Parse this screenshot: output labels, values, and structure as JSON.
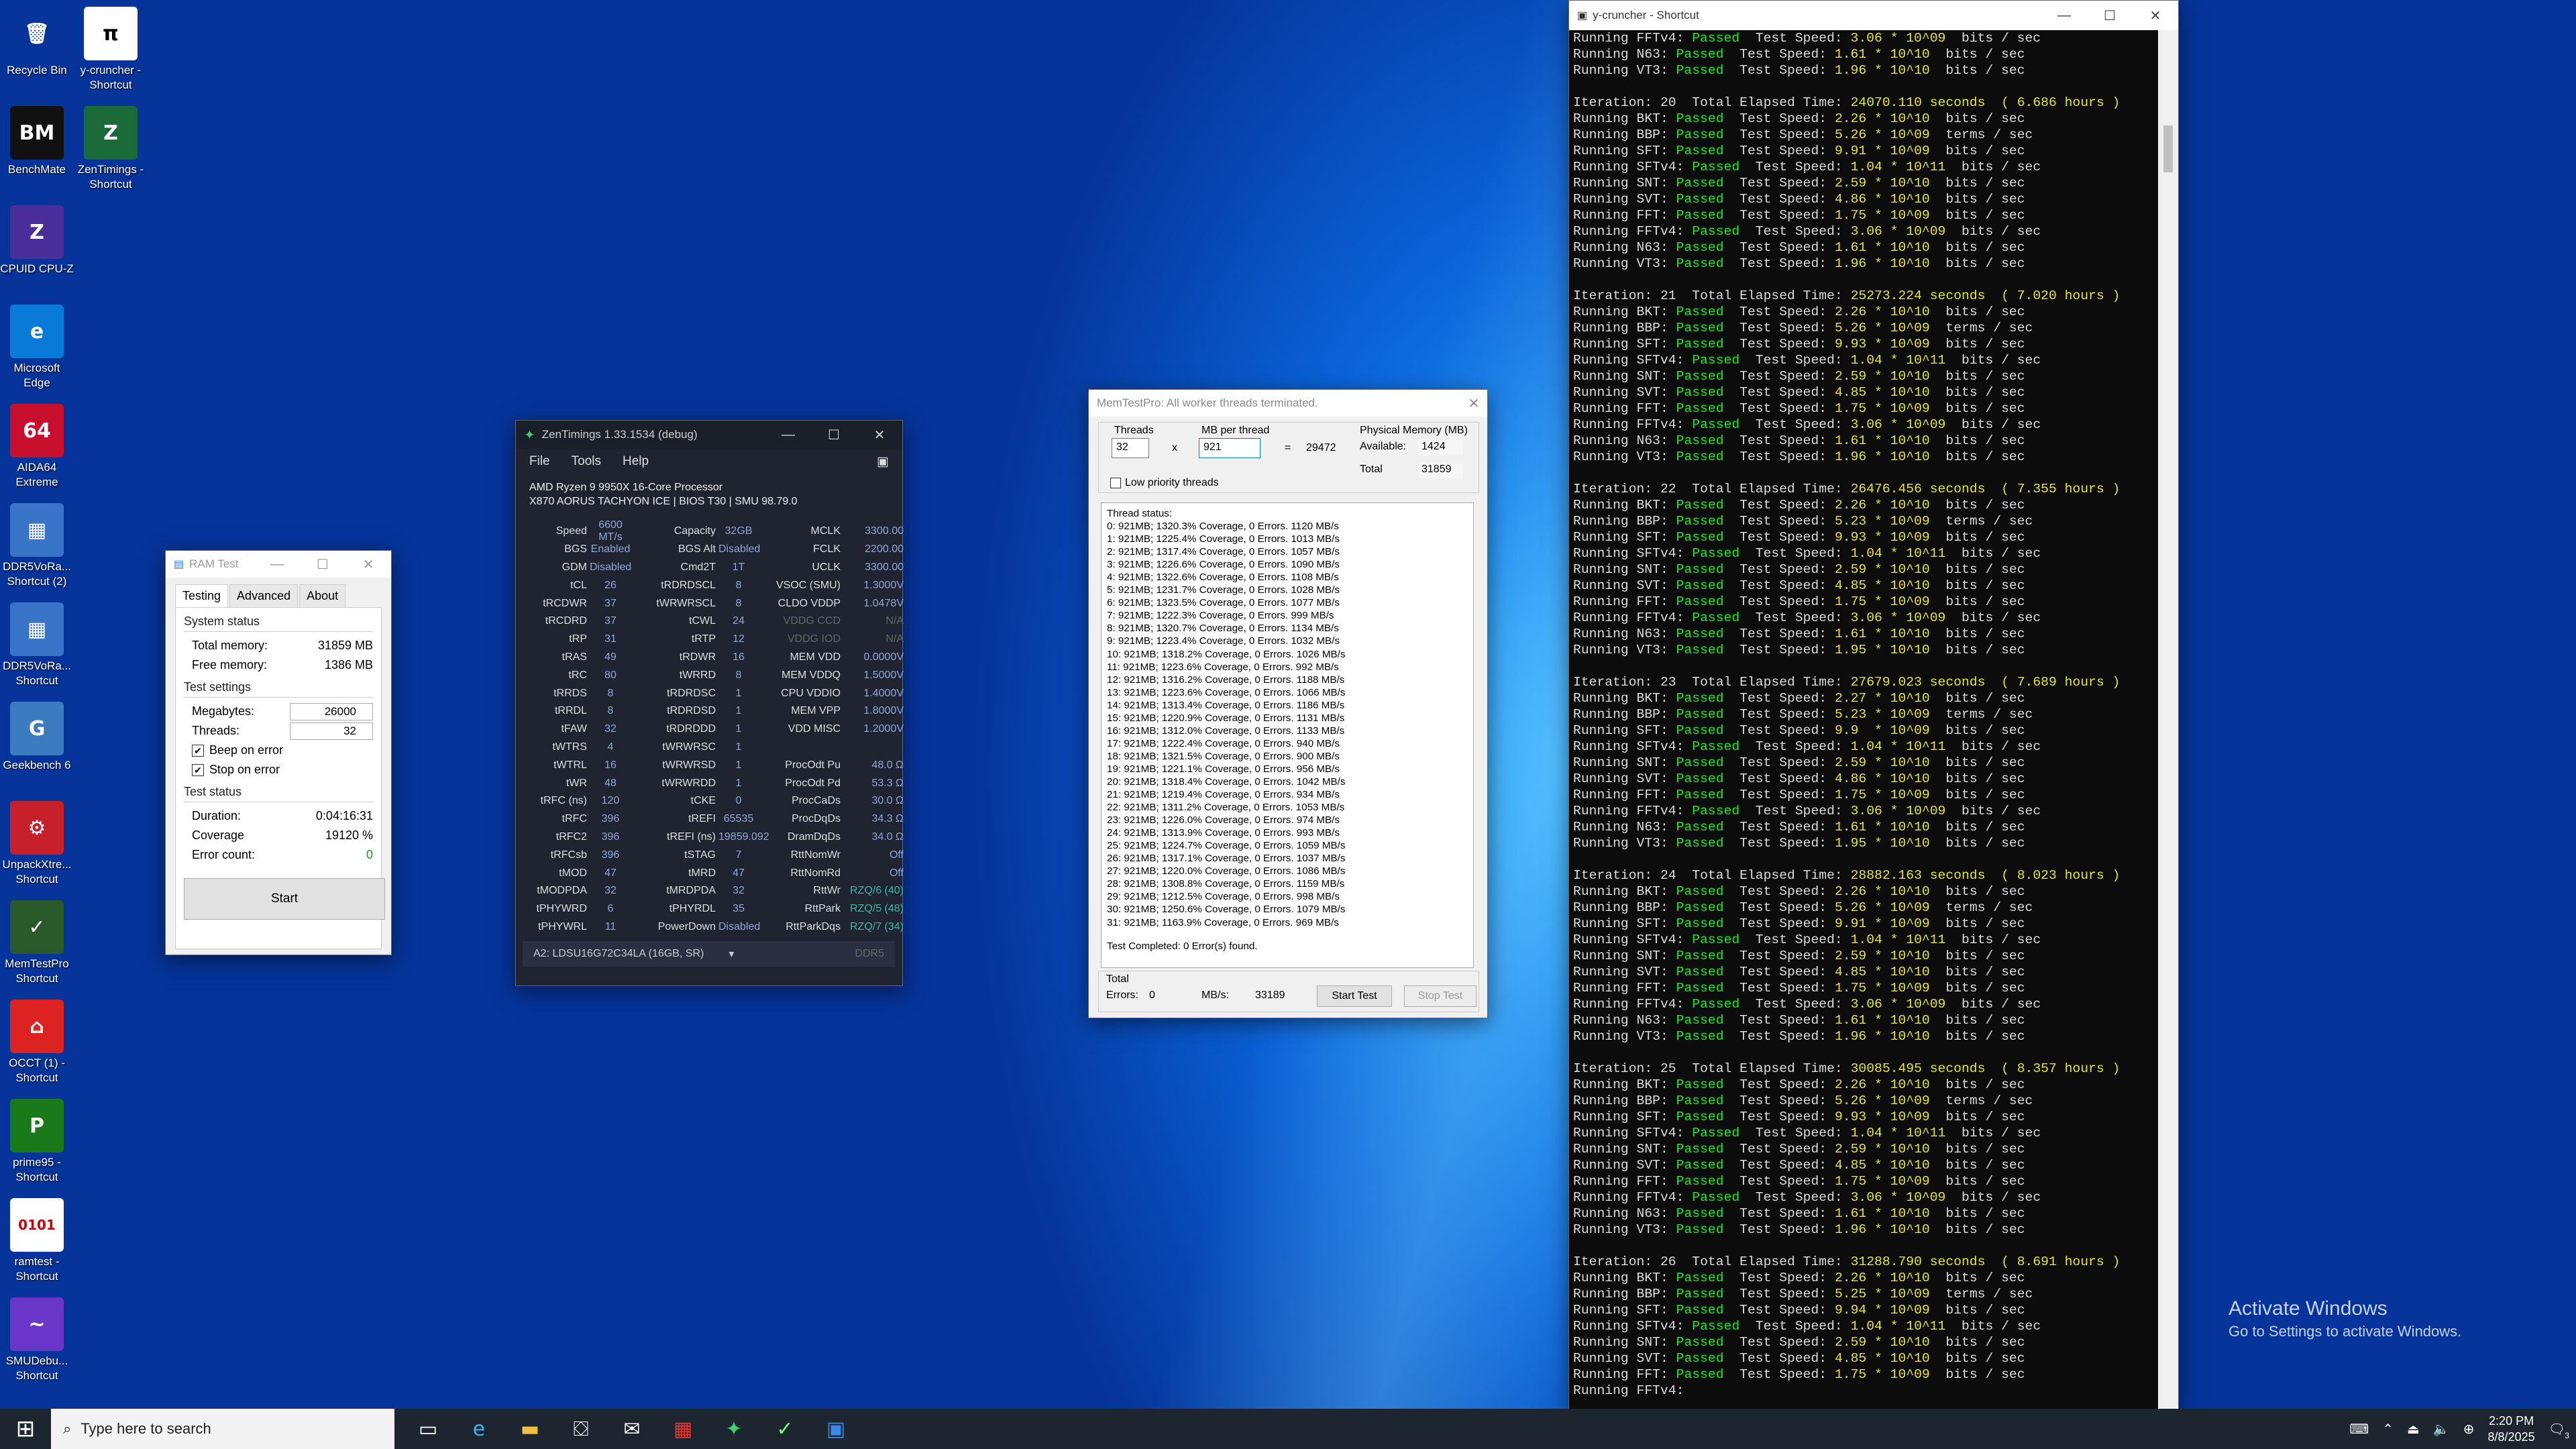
{
  "desktop": {
    "icons": [
      {
        "label": "Recycle Bin",
        "glyph": "🗑",
        "bg": "transparent"
      },
      {
        "label": "BenchMate",
        "glyph": "BM",
        "bg": "#111"
      },
      {
        "label": "CPUID CPU-Z",
        "glyph": "Z",
        "bg": "#4a2f9a"
      },
      {
        "label": "Microsoft\nEdge",
        "glyph": "e",
        "bg": "#0a7ad8"
      },
      {
        "label": "AIDA64\nExtreme",
        "glyph": "64",
        "bg": "#c8102e"
      },
      {
        "label": "DDR5VoRa...\nShortcut (2)",
        "glyph": "▦",
        "bg": "#3a74c8"
      },
      {
        "label": "DDR5VoRa...\nShortcut",
        "glyph": "▦",
        "bg": "#3a74c8"
      },
      {
        "label": "Geekbench 6",
        "glyph": "G",
        "bg": "#3b7bbf"
      },
      {
        "label": "UnpackXtre...\nShortcut",
        "glyph": "⚙",
        "bg": "#c8202a"
      },
      {
        "label": "MemTestPro\nShortcut",
        "glyph": "✓",
        "bg": "#2a5a2a"
      },
      {
        "label": "OCCT (1) -\nShortcut",
        "glyph": "⌂",
        "bg": "#d22"
      },
      {
        "label": "prime95 -\nShortcut",
        "glyph": "P",
        "bg": "#1a7a1a"
      },
      {
        "label": "ramtest -\nShortcut",
        "glyph": "0101",
        "bg": "#fff"
      },
      {
        "label": "SMUDebu...\nShortcut",
        "glyph": "~",
        "bg": "#6a36c8"
      }
    ],
    "icons_right": [
      {
        "label": "y-cruncher -\nShortcut",
        "glyph": "π",
        "bg": "#fff"
      },
      {
        "label": "ZenTimings -\nShortcut",
        "glyph": "Z",
        "bg": "#1a6a3a"
      }
    ],
    "activate_title": "Activate Windows",
    "activate_sub": "Go to Settings to activate Windows."
  },
  "ramtest": {
    "title": "RAM Test",
    "tabs": [
      "Testing",
      "Advanced",
      "About"
    ],
    "system_status": "System status",
    "total_memory_label": "Total memory:",
    "total_memory": "31859 MB",
    "free_memory_label": "Free memory:",
    "free_memory": "1386 MB",
    "test_settings": "Test settings",
    "megabytes_label": "Megabytes:",
    "megabytes": "26000",
    "threads_label": "Threads:",
    "threads": "32",
    "beep": "Beep on error",
    "stop": "Stop on error",
    "test_status": "Test status",
    "duration_label": "Duration:",
    "duration": "0:04:16:31",
    "coverage_label": "Coverage",
    "coverage": "19120 %",
    "errors_label": "Error count:",
    "errors": "0",
    "start": "Start"
  },
  "zen": {
    "title": "ZenTimings 1.33.1534 (debug)",
    "menu": [
      "File",
      "Tools",
      "Help"
    ],
    "cpu": "AMD Ryzen 9 9950X 16-Core Processor",
    "board": "X870 AORUS TACHYON ICE | BIOS T30 | SMU 98.79.0",
    "rows": [
      [
        "Speed",
        "6600 MT/s",
        "Capacity",
        "32GB",
        "MCLK",
        "3300.00"
      ],
      [
        "BGS",
        "Enabled",
        "BGS Alt",
        "Disabled",
        "FCLK",
        "2200.00"
      ],
      [
        "GDM",
        "Disabled",
        "Cmd2T",
        "1T",
        "UCLK",
        "3300.00"
      ],
      [
        "tCL",
        "26",
        "tRDRDSCL",
        "8",
        "VSOC (SMU)",
        "1.3000V"
      ],
      [
        "tRCDWR",
        "37",
        "tWRWRSCL",
        "8",
        "CLDO VDDP",
        "1.0478V"
      ],
      [
        "tRCDRD",
        "37",
        "tCWL",
        "24",
        "VDDG CCD",
        "N/A"
      ],
      [
        "tRP",
        "31",
        "tRTP",
        "12",
        "VDDG IOD",
        "N/A"
      ],
      [
        "tRAS",
        "49",
        "tRDWR",
        "16",
        "MEM VDD",
        "0.0000V"
      ],
      [
        "tRC",
        "80",
        "tWRRD",
        "8",
        "MEM VDDQ",
        "1.5000V"
      ],
      [
        "tRRDS",
        "8",
        "tRDRDSC",
        "1",
        "CPU VDDIO",
        "1.4000V"
      ],
      [
        "tRRDL",
        "8",
        "tRDRDSD",
        "1",
        "MEM VPP",
        "1.8000V"
      ],
      [
        "tFAW",
        "32",
        "tRDRDDD",
        "1",
        "VDD MISC",
        "1.2000V"
      ],
      [
        "tWTRS",
        "4",
        "tWRWRSC",
        "1",
        "",
        ""
      ],
      [
        "tWTRL",
        "16",
        "tWRWRSD",
        "1",
        "ProcOdt Pu",
        "48.0 Ω"
      ],
      [
        "tWR",
        "48",
        "tWRWRDD",
        "1",
        "ProcOdt Pd",
        "53.3 Ω"
      ],
      [
        "tRFC (ns)",
        "120",
        "tCKE",
        "0",
        "ProcCaDs",
        "30.0 Ω"
      ],
      [
        "tRFC",
        "396",
        "tREFI",
        "65535",
        "ProcDqDs",
        "34.3 Ω"
      ],
      [
        "tRFC2",
        "396",
        "tREFI (ns)",
        "19859.092",
        "DramDqDs",
        "34.0 Ω"
      ],
      [
        "tRFCsb",
        "396",
        "tSTAG",
        "7",
        "RttNomWr",
        "Off"
      ],
      [
        "tMOD",
        "47",
        "tMRD",
        "47",
        "RttNomRd",
        "Off"
      ],
      [
        "tMODPDA",
        "32",
        "tMRDPDA",
        "32",
        "RttWr",
        "RZQ/6 (40)"
      ],
      [
        "tPHYWRD",
        "6",
        "tPHYRDL",
        "35",
        "RttPark",
        "RZQ/5 (48)"
      ],
      [
        "tPHYWRL",
        "11",
        "PowerDown",
        "Disabled",
        "RttParkDqs",
        "RZQ/7 (34)"
      ]
    ],
    "dimm": "A2: LDSU16G72C34LA (16GB, SR)",
    "ddr": "DDR5"
  },
  "mtp": {
    "title": "MemTestPro: All worker threads terminated.",
    "threads_label": "Threads",
    "threads": "32",
    "mb_label": "MB per thread",
    "mb": "921",
    "x": "x",
    "eq": "=",
    "total": "29472",
    "phys_label": "Physical Memory (MB)",
    "avail_label": "Available:",
    "avail": "1424",
    "total_label": "Total",
    "phys_total": "31859",
    "low_priority": "Low priority threads",
    "status_header": "Thread status:",
    "lines": [
      "0: 921MB; 1320.3% Coverage, 0 Errors. 1120 MB/s",
      "1: 921MB; 1225.4% Coverage, 0 Errors. 1013 MB/s",
      "2: 921MB; 1317.4% Coverage, 0 Errors. 1057 MB/s",
      "3: 921MB; 1226.6% Coverage, 0 Errors. 1090 MB/s",
      "4: 921MB; 1322.6% Coverage, 0 Errors. 1108 MB/s",
      "5: 921MB; 1231.7% Coverage, 0 Errors. 1028 MB/s",
      "6: 921MB; 1323.5% Coverage, 0 Errors. 1077 MB/s",
      "7: 921MB; 1222.3% Coverage, 0 Errors. 999 MB/s",
      "8: 921MB; 1320.7% Coverage, 0 Errors. 1134 MB/s",
      "9: 921MB; 1223.4% Coverage, 0 Errors. 1032 MB/s",
      "10: 921MB; 1318.2% Coverage, 0 Errors. 1026 MB/s",
      "11: 921MB; 1223.6% Coverage, 0 Errors. 992 MB/s",
      "12: 921MB; 1316.2% Coverage, 0 Errors. 1188 MB/s",
      "13: 921MB; 1223.6% Coverage, 0 Errors. 1066 MB/s",
      "14: 921MB; 1313.4% Coverage, 0 Errors. 1186 MB/s",
      "15: 921MB; 1220.9% Coverage, 0 Errors. 1131 MB/s",
      "16: 921MB; 1312.0% Coverage, 0 Errors. 1133 MB/s",
      "17: 921MB; 1222.4% Coverage, 0 Errors. 940 MB/s",
      "18: 921MB; 1321.5% Coverage, 0 Errors. 900 MB/s",
      "19: 921MB; 1221.1% Coverage, 0 Errors. 956 MB/s",
      "20: 921MB; 1318.4% Coverage, 0 Errors. 1042 MB/s",
      "21: 921MB; 1219.4% Coverage, 0 Errors. 934 MB/s",
      "22: 921MB; 1311.2% Coverage, 0 Errors. 1053 MB/s",
      "23: 921MB; 1226.0% Coverage, 0 Errors. 974 MB/s",
      "24: 921MB; 1313.9% Coverage, 0 Errors. 993 MB/s",
      "25: 921MB; 1224.7% Coverage, 0 Errors. 1059 MB/s",
      "26: 921MB; 1317.1% Coverage, 0 Errors. 1037 MB/s",
      "27: 921MB; 1220.0% Coverage, 0 Errors. 1086 MB/s",
      "28: 921MB; 1308.8% Coverage, 0 Errors. 1159 MB/s",
      "29: 921MB; 1212.5% Coverage, 0 Errors. 998 MB/s",
      "30: 921MB; 1250.6% Coverage, 0 Errors. 1079 MB/s",
      "31: 921MB; 1163.9% Coverage, 0 Errors. 969 MB/s"
    ],
    "complete": "Test Completed: 0 Error(s) found.",
    "errors_label": "Errors:",
    "errors": "0",
    "mbs_label": "MB/s:",
    "mbs": "33189",
    "start": "Start Test",
    "stop": "Stop Test"
  },
  "term": {
    "title": "y-cruncher - Shortcut",
    "pre": [
      [
        "SFFTv4",
        "3.06 * 10^09",
        "bits / sec"
      ],
      [
        "N63",
        "1.61 * 10^10",
        "bits / sec"
      ],
      [
        "VT3",
        "1.96 * 10^10",
        "bits / sec"
      ]
    ],
    "iterations": [
      {
        "n": "20",
        "secs": "24070.110 seconds",
        "hours": "( 6.686 hours )",
        "v": [
          "2.26 * 10^10",
          "5.26 * 10^09",
          "9.91 * 10^09",
          "1.04 * 10^11",
          "2.59 * 10^10",
          "4.86 * 10^10",
          "1.75 * 10^09",
          "3.06 * 10^09",
          "1.61 * 10^10",
          "1.96 * 10^10"
        ]
      },
      {
        "n": "21",
        "secs": "25273.224 seconds",
        "hours": "( 7.020 hours )",
        "v": [
          "2.26 * 10^10",
          "5.26 * 10^09",
          "9.93 * 10^09",
          "1.04 * 10^11",
          "2.59 * 10^10",
          "4.85 * 10^10",
          "1.75 * 10^09",
          "3.06 * 10^09",
          "1.61 * 10^10",
          "1.96 * 10^10"
        ]
      },
      {
        "n": "22",
        "secs": "26476.456 seconds",
        "hours": "( 7.355 hours )",
        "v": [
          "2.26 * 10^10",
          "5.23 * 10^09",
          "9.93 * 10^09",
          "1.04 * 10^11",
          "2.59 * 10^10",
          "4.85 * 10^10",
          "1.75 * 10^09",
          "3.06 * 10^09",
          "1.61 * 10^10",
          "1.95 * 10^10"
        ]
      },
      {
        "n": "23",
        "secs": "27679.023 seconds",
        "hours": "( 7.689 hours )",
        "v": [
          "2.27 * 10^10",
          "5.23 * 10^09",
          "9.9  * 10^09",
          "1.04 * 10^11",
          "2.59 * 10^10",
          "4.86 * 10^10",
          "1.75 * 10^09",
          "3.06 * 10^09",
          "1.61 * 10^10",
          "1.95 * 10^10"
        ]
      },
      {
        "n": "24",
        "secs": "28882.163 seconds",
        "hours": "( 8.023 hours )",
        "v": [
          "2.26 * 10^10",
          "5.26 * 10^09",
          "9.91 * 10^09",
          "1.04 * 10^11",
          "2.59 * 10^10",
          "4.85 * 10^10",
          "1.75 * 10^09",
          "3.06 * 10^09",
          "1.61 * 10^10",
          "1.96 * 10^10"
        ]
      },
      {
        "n": "25",
        "secs": "30085.495 seconds",
        "hours": "( 8.357 hours )",
        "v": [
          "2.26 * 10^10",
          "5.26 * 10^09",
          "9.93 * 10^09",
          "1.04 * 10^11",
          "2.59 * 10^10",
          "4.85 * 10^10",
          "1.75 * 10^09",
          "3.06 * 10^09",
          "1.61 * 10^10",
          "1.96 * 10^10"
        ]
      },
      {
        "n": "26",
        "secs": "31288.790 seconds",
        "hours": "( 8.691 hours )",
        "v": [
          "2.26 * 10^10",
          "5.25 * 10^09",
          "9.94 * 10^09",
          "1.04 * 10^11",
          "2.59 * 10^10",
          "4.85 * 10^10",
          "1.75 * 10^09"
        ]
      }
    ],
    "tests": [
      "BKT",
      "BBP",
      "SFT",
      "SFTv4",
      "SNT",
      "SVT",
      "FFT",
      "FFTv4",
      "N63",
      "VT3"
    ],
    "units": [
      "bits / sec",
      "terms / sec",
      "bits / sec",
      "bits / sec",
      "bits / sec",
      "bits / sec",
      "bits / sec",
      "bits / sec",
      "bits / sec",
      "bits / sec"
    ],
    "last": "FFTv4",
    "iteration_word": "Iteration:",
    "elapsed_word": "Total Elapsed Time:",
    "running": "Running",
    "passed": "Passed",
    "speed": "Test Speed:"
  },
  "taskbar": {
    "search": "Type here to search",
    "time": "2:20 PM",
    "date": "8/8/2025",
    "notif": "3"
  }
}
